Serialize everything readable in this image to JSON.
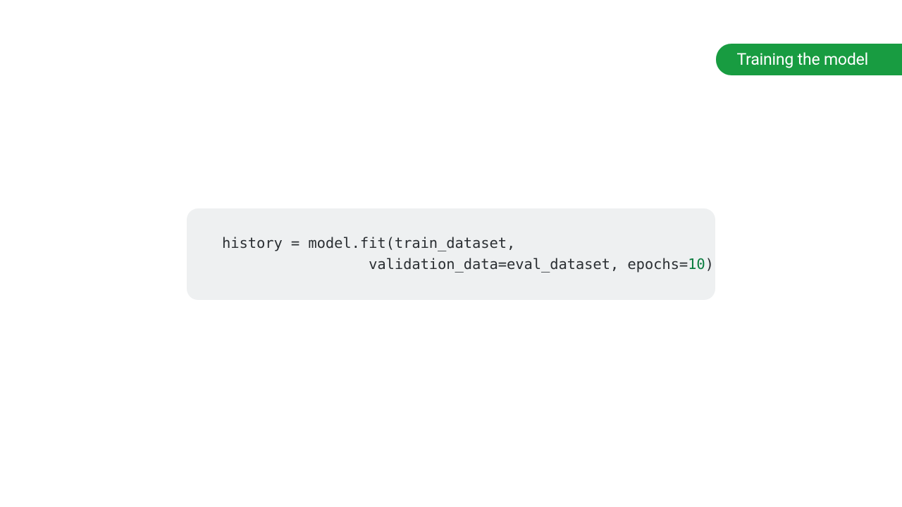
{
  "badge": {
    "label": "Training the model",
    "color": "#189c41"
  },
  "code": {
    "line1_a": "history = model.fit(train_dataset,",
    "line2_a": "                 validation_data=eval_dataset, epochs=",
    "line2_num": "10",
    "line2_b": ")"
  }
}
